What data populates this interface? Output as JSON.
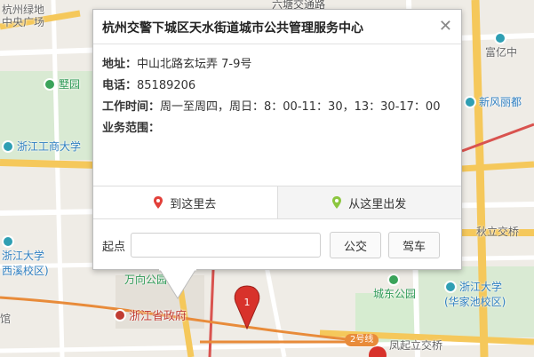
{
  "map": {
    "labels": {
      "hangzhou_green": "杭州绿地",
      "zhongyang_square": "中央广场",
      "liushui": "六塘交通路",
      "ye_garden": "墅园",
      "zhejiang_gongshang": "浙江工商大学",
      "fuyi": "富亿中",
      "xinfengli": "新风丽都",
      "zjdx_xixi": "浙江大学",
      "zjdx_xixi_sub": "西溪校区)",
      "wanxiang": "万向公园",
      "provincial_gov": "浙江省政府",
      "qiuli": "秋立交桥",
      "chengdong_park": "城东公园",
      "zjdx_huajiachi": "浙江大学",
      "zjdx_huajiachi_sub": "(华家池校区)",
      "fengqi": "凤起立交桥",
      "metro_line2": "2号线",
      "museum": "馆"
    },
    "colors": {
      "road_major": "#f5c85b",
      "road_red": "#d9534f",
      "road_white": "#ffffff",
      "green": "#d6ecd0",
      "metro": "#e88b3a"
    }
  },
  "popup": {
    "title": "杭州交警下城区天水街道城市公共管理服务中心",
    "close_symbol": "✕",
    "address_label": "地址：",
    "address_value": "中山北路玄坛弄 7-9号",
    "phone_label": "电话：",
    "phone_value": "85189206",
    "hours_label": "工作时间：",
    "hours_value": "周一至周四，周日：8：00-11：30，13：30-17：00",
    "scope_label": "业务范围：",
    "scope_value": "",
    "tab_to": "到这里去",
    "tab_from": "从这里出发",
    "start_label": "起点",
    "start_placeholder": "",
    "bus_button": "公交",
    "drive_button": "驾车"
  }
}
